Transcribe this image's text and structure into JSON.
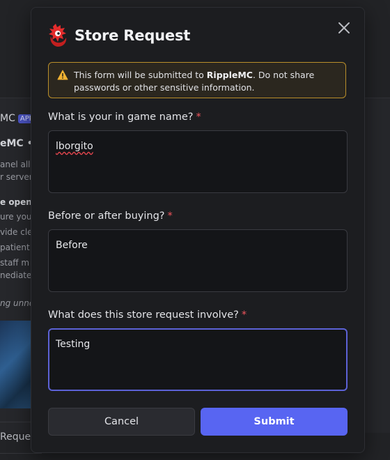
{
  "background": {
    "fragments": [
      "MC",
      "APP",
      "eMC • ",
      "anel allo",
      "r server",
      "e openin",
      "ure you",
      "vide cle",
      "patient",
      " staff m",
      "nediatel",
      "ng unne",
      "Reque"
    ]
  },
  "modal": {
    "title": "Store Request",
    "warning": {
      "prefix": "This form will be submitted to ",
      "brand": "RippleMC",
      "suffix": ". Do not share passwords or other sensitive information."
    },
    "fields": [
      {
        "label": "What is your in game name?",
        "required_mark": "*",
        "value": "lborgito"
      },
      {
        "label": "Before or after buying?",
        "required_mark": "*",
        "value": "Before"
      },
      {
        "label": "What does this store request involve?",
        "required_mark": "*",
        "value": "Testing"
      }
    ],
    "buttons": {
      "cancel": "Cancel",
      "submit": "Submit"
    }
  },
  "colors": {
    "accent": "#5865f2",
    "warning_border": "#b98e2a",
    "required": "#f0545c",
    "logo_red": "#e32c2c"
  },
  "icons": {
    "logo": "ripplemc-logo-icon",
    "close": "close-icon",
    "warning": "warning-triangle-icon"
  }
}
